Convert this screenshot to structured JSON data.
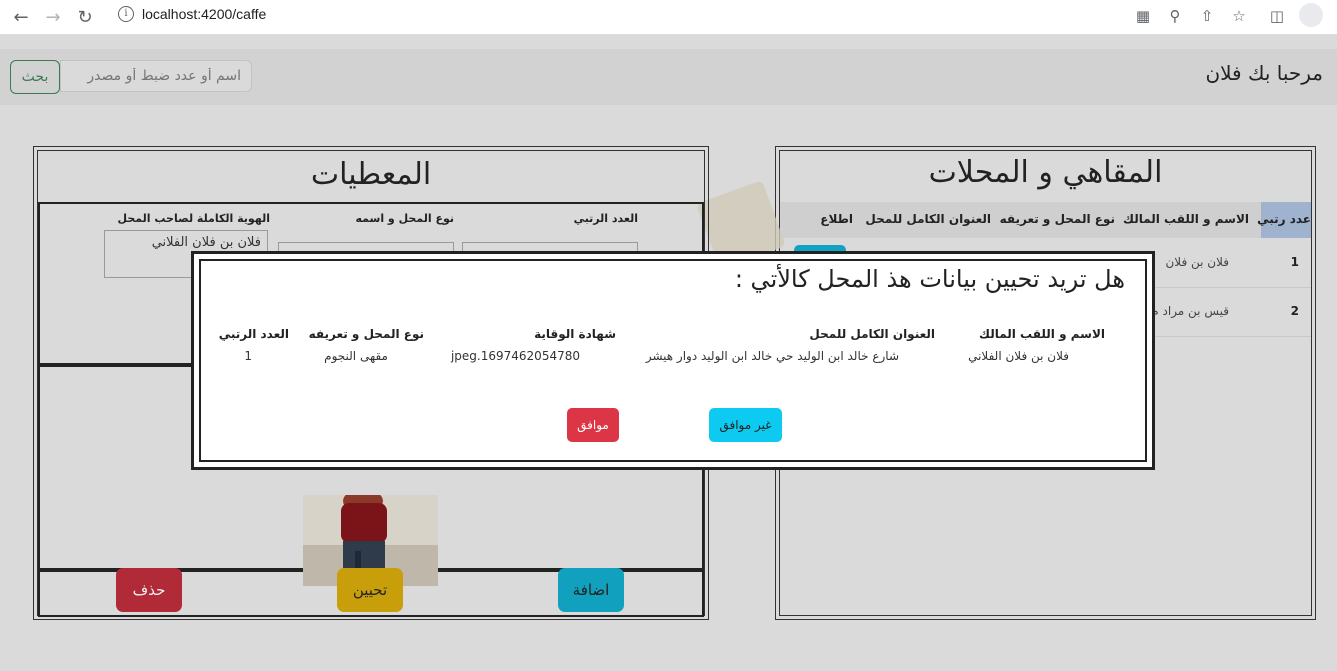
{
  "browser": {
    "url": "localhost:4200/caffe"
  },
  "header": {
    "greeting": "مرحبا بك فلان",
    "search_placeholder": "اسم أو عدد ضبط أو مصدر",
    "search_button": "بحث"
  },
  "cafes_panel": {
    "title": "المقاهي و المحلات",
    "columns": [
      "عدد رتبي",
      "الاسم و اللقب المالك",
      "نوع المحل و تعريفه",
      "العنوان الكامل للمحل",
      "اطلاع"
    ],
    "rows": [
      {
        "num": "1",
        "owner": "فلان بن فلان"
      },
      {
        "num": "2",
        "owner": "قيس بن مراد م"
      }
    ]
  },
  "data_panel": {
    "title": "المعطيات",
    "labels": {
      "serial": "العدد الرتبي",
      "type_name": "نوع المحل و اسمه",
      "owner_id": "الهوية الكاملة لصاحب المحل"
    },
    "owner_value": "فلان بن فلان الفلاني",
    "buttons": {
      "delete": "حذف",
      "update": "تحيين",
      "add": "اضافة"
    }
  },
  "modal": {
    "title": "هل تريد تحيين بيانات هذ المحل كالأتي :",
    "headers": {
      "owner": "الاسم و اللقب المالك",
      "address": "العنوان الكامل للمحل",
      "certificate": "شهادة الوقاية",
      "type": "نوع المحل و تعريفه",
      "serial": "العدد الرتبي"
    },
    "values": {
      "owner": "فلان بن فلان الفلاني",
      "address": "شارع خالد ابن الوليد حي خالد ابن الوليد دوار هيشر",
      "certificate": "jpeg.1697462054780",
      "type": "مقهى النجوم",
      "serial": "1"
    },
    "cancel_label": "غير موافق",
    "confirm_label": "موافق"
  },
  "colors": {
    "confirm": "#dc3545",
    "cancel": "#0dcaf0",
    "delete": "#b02a37",
    "update": "#c89f0a",
    "add": "#11a0bd",
    "search": "#3b7a52"
  }
}
